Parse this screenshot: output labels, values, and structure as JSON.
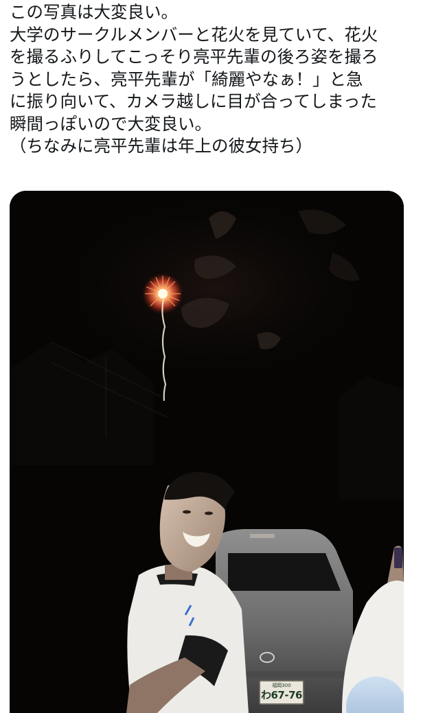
{
  "tweet": {
    "lines": [
      "この写真は大変良い。",
      "大学のサークルメンバーと花火を見ていて、花火",
      "を撮るふりしてこっそり亮平先輩の後ろ姿を撮ろ",
      "うとしたら、亮平先輩が「綺麗やなぁ！」と急",
      "に振り向いて、カメラ越しに目が合ってしまった",
      "瞬間っぽいので大変良い。",
      "（ちなみに亮平先輩は年上の彼女持ち）"
    ]
  },
  "media": {
    "license_plate": {
      "top": "福岡300",
      "bottom": "わ67-76"
    }
  }
}
